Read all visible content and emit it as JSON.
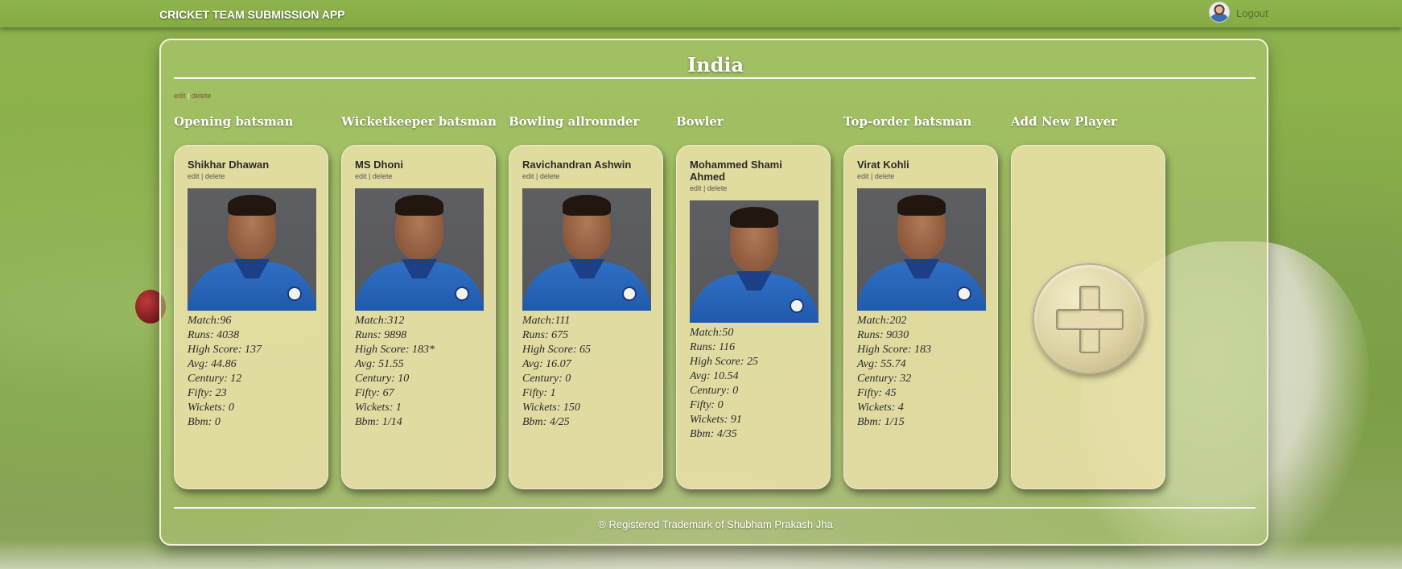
{
  "app": {
    "title": "CRICKET TEAM SUBMISSION APP",
    "logout_label": "Logout"
  },
  "team": {
    "name": "India",
    "edit_label": "edit",
    "delete_label": "delete",
    "separator": "|"
  },
  "players": [
    {
      "role": "Opening batsman",
      "name": "Shikhar Dhawan",
      "edit_label": "edit",
      "separator": "|",
      "delete_label": "delete",
      "stats": [
        "Match:96",
        "Runs: 4038",
        "High Score: 137",
        "Avg: 44.86",
        "Century: 12",
        "Fifty: 23",
        "Wickets: 0",
        "Bbm: 0"
      ]
    },
    {
      "role": "Wicketkeeper batsman",
      "name": "MS Dhoni",
      "edit_label": "edit",
      "separator": "|",
      "delete_label": "delete",
      "stats": [
        "Match:312",
        "Runs: 9898",
        "High Score: 183*",
        "Avg: 51.55",
        "Century: 10",
        "Fifty: 67",
        "Wickets: 1",
        "Bbm: 1/14"
      ]
    },
    {
      "role": "Bowling allrounder",
      "name": "Ravichandran Ashwin",
      "edit_label": "edit",
      "separator": "|",
      "delete_label": "delete",
      "stats": [
        "Match:111",
        "Runs: 675",
        "High Score: 65",
        "Avg: 16.07",
        "Century: 0",
        "Fifty: 1",
        "Wickets: 150",
        "Bbm: 4/25"
      ]
    },
    {
      "role": "Bowler",
      "name_line1": "Mohammed Shami",
      "name_line2": "Ahmed",
      "edit_label": "edit",
      "separator": "|",
      "delete_label": "delete",
      "stats": [
        "Match:50",
        "Runs: 116",
        "High Score: 25",
        "Avg: 10.54",
        "Century: 0",
        "Fifty: 0",
        "Wickets: 91",
        "Bbm: 4/35"
      ]
    },
    {
      "role": "Top-order batsman",
      "name": "Virat Kohli",
      "edit_label": "edit",
      "separator": "|",
      "delete_label": "delete",
      "stats": [
        "Match:202",
        "Runs: 9030",
        "High Score: 183",
        "Avg: 55.74",
        "Century: 32",
        "Fifty: 45",
        "Wickets: 4",
        "Bbm: 1/15"
      ]
    }
  ],
  "add_player": {
    "heading": "Add New Player",
    "icon": "plus-icon"
  },
  "footer": {
    "text": "® Registered Trademark of Shubham Prakash Jha"
  },
  "colors": {
    "background_green": "#8ab049",
    "panel_border": "#f4f2da",
    "card_bg": "#eee2ac",
    "jersey_blue": "#2e6fc4"
  }
}
